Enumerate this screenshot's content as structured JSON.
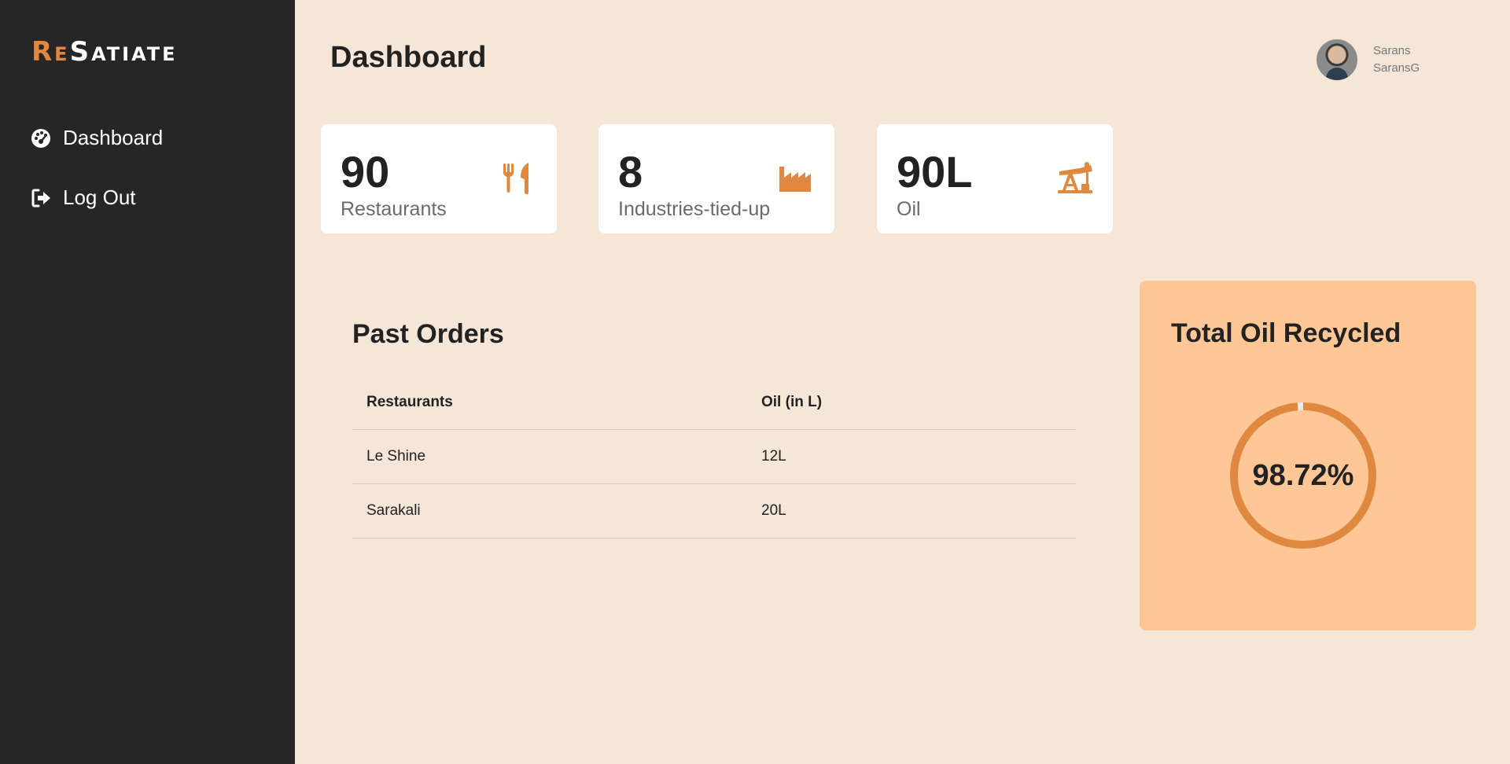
{
  "brand": {
    "logo_first": "Re",
    "logo_rest": "Satiate",
    "accent_color": "#e0883f"
  },
  "sidebar": {
    "items": [
      {
        "label": "Dashboard",
        "icon": "gauge-icon"
      },
      {
        "label": "Log Out",
        "icon": "logout-icon"
      }
    ]
  },
  "header": {
    "title": "Dashboard"
  },
  "user": {
    "name": "Sarans",
    "username": "SaransG"
  },
  "stats": [
    {
      "value": "90",
      "label": "Restaurants",
      "icon": "utensils-icon"
    },
    {
      "value": "8",
      "label": "Industries-tied-up",
      "icon": "industry-icon"
    },
    {
      "value": "90L",
      "label": "Oil",
      "icon": "oil-pump-icon"
    }
  ],
  "orders": {
    "title": "Past Orders",
    "columns": [
      "Restaurants",
      "Oil (in L)"
    ],
    "rows": [
      [
        "Le Shine",
        "12L"
      ],
      [
        "Sarakali",
        "20L"
      ]
    ]
  },
  "recycled": {
    "title": "Total Oil Recycled",
    "value_text": "98.72%",
    "fraction": 0.9872,
    "ring_color": "#e0883f",
    "remainder_color": "#e8e8e8"
  }
}
